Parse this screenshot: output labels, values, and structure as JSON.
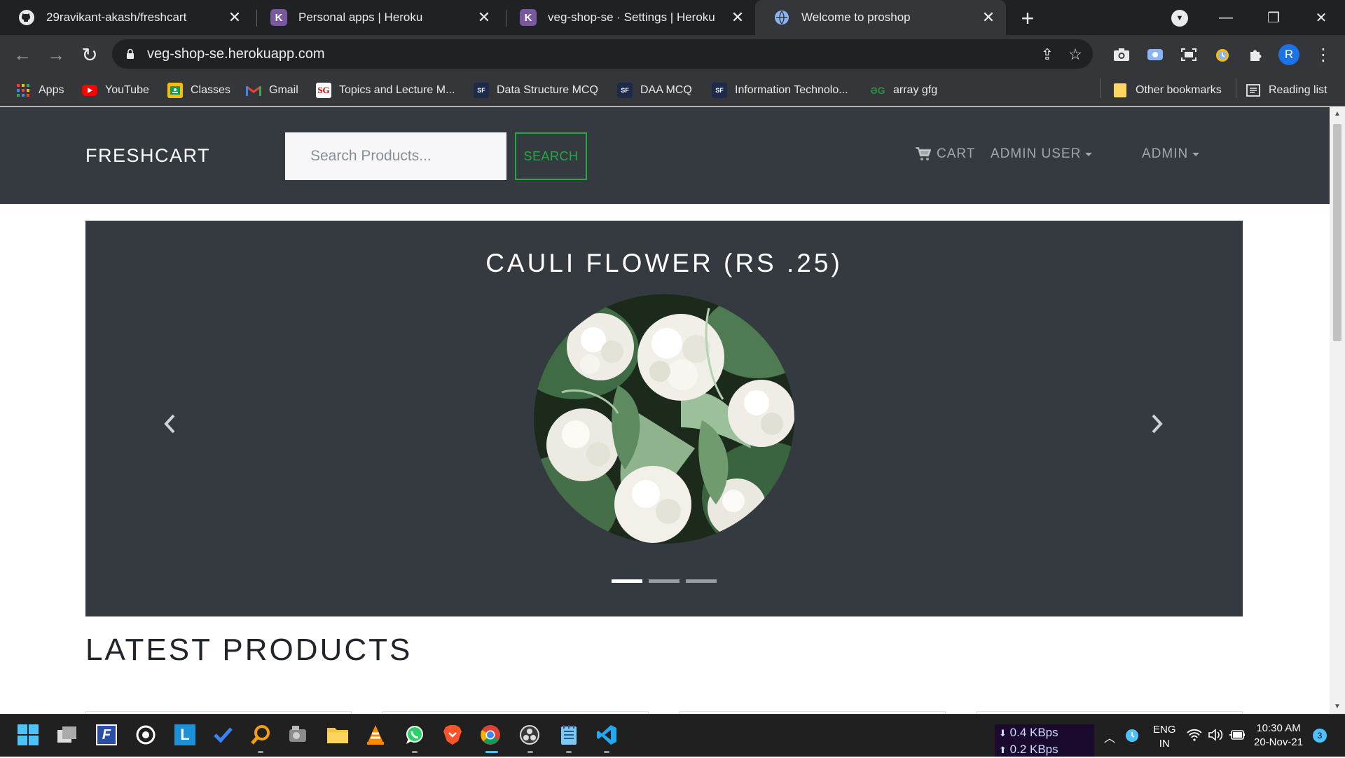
{
  "browser": {
    "tabs": [
      {
        "title": "29ravikant-akash/freshcart",
        "icon": "github-icon",
        "active": false
      },
      {
        "title": "Personal apps | Heroku",
        "icon": "heroku-icon",
        "active": false
      },
      {
        "title": "veg-shop-se · Settings | Heroku",
        "icon": "heroku-icon",
        "active": false
      },
      {
        "title": "Welcome to proshop",
        "icon": "globe-icon",
        "active": true
      }
    ],
    "url": "veg-shop-se.herokuapp.com",
    "profile_initial": "R",
    "bookmarks": [
      {
        "label": "Apps",
        "icon": "apps-grid-icon"
      },
      {
        "label": "YouTube",
        "icon": "youtube-icon"
      },
      {
        "label": "Classes",
        "icon": "classroom-icon"
      },
      {
        "label": "Gmail",
        "icon": "gmail-icon"
      },
      {
        "label": "Topics and Lecture M...",
        "icon": "sg-icon"
      },
      {
        "label": "Data Structure MCQ",
        "icon": "sf-icon"
      },
      {
        "label": "DAA MCQ",
        "icon": "sf-icon"
      },
      {
        "label": "Information Technolo...",
        "icon": "sf-icon"
      },
      {
        "label": "array gfg",
        "icon": "gfg-icon"
      }
    ],
    "other_bookmarks": "Other bookmarks",
    "reading_list": "Reading list",
    "colors": {
      "frame": "#202124",
      "toolbar": "#35363a",
      "text": "#e8eaed"
    }
  },
  "site": {
    "brand": "FRESHCART",
    "search_placeholder": "Search Products...",
    "search_button": "SEARCH",
    "nav": {
      "cart": "CART",
      "user": "ADMIN USER",
      "admin": "ADMIN"
    },
    "carousel": {
      "slide_title": "CAULI FLOWER (RS .25)",
      "slide_count": 3,
      "active_slide": 1
    },
    "section_title": "LATEST PRODUCTS",
    "colors": {
      "navbar": "#343a40",
      "accent": "#28a745"
    }
  },
  "taskbar": {
    "net_down": "0.4 KBps",
    "net_up": "0.2 KBps",
    "lang_top": "ENG",
    "lang_bottom": "IN",
    "time": "10:30 AM",
    "date": "20-Nov-21",
    "notifications": "3"
  }
}
